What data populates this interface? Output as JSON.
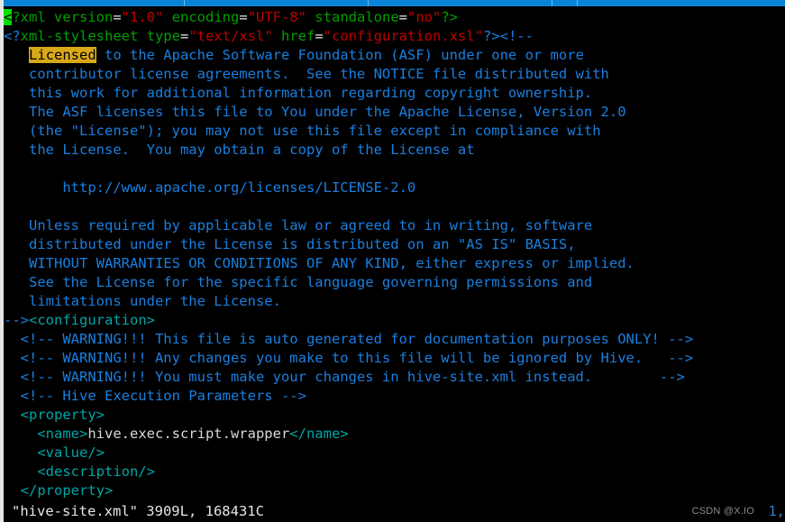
{
  "window": {
    "titlebar_color": "#0a84d8",
    "background_color": "#000000"
  },
  "editor": {
    "name": "vim",
    "filename": "hive-site.xml",
    "search_term": "Licensed",
    "cursor_char": "<",
    "lines": [
      {
        "id": "line-1",
        "segments": [
          {
            "text": "<",
            "style": "cursor"
          },
          {
            "text": "?xml version",
            "style": "green"
          },
          {
            "text": "=",
            "style": "white"
          },
          {
            "text": "\"1.0\"",
            "style": "red"
          },
          {
            "text": " encoding",
            "style": "green"
          },
          {
            "text": "=",
            "style": "white"
          },
          {
            "text": "\"UTF-8\"",
            "style": "red"
          },
          {
            "text": " standalone",
            "style": "green"
          },
          {
            "text": "=",
            "style": "white"
          },
          {
            "text": "\"no\"",
            "style": "red"
          },
          {
            "text": "?>",
            "style": "green"
          }
        ]
      },
      {
        "id": "line-2",
        "segments": [
          {
            "text": "<?",
            "style": "blue"
          },
          {
            "text": "xml-stylesheet type",
            "style": "green"
          },
          {
            "text": "=",
            "style": "white"
          },
          {
            "text": "\"text/xsl\"",
            "style": "red"
          },
          {
            "text": " href",
            "style": "green"
          },
          {
            "text": "=",
            "style": "white"
          },
          {
            "text": "\"configuration.xsl\"",
            "style": "red"
          },
          {
            "text": "?>",
            "style": "blue"
          },
          {
            "text": "<!--",
            "style": "blue"
          }
        ]
      },
      {
        "id": "line-3",
        "segments": [
          {
            "text": "   ",
            "style": "blue"
          },
          {
            "text": "Licensed",
            "style": "search-hit"
          },
          {
            "text": " to the Apache Software Foundation (ASF) under one or more",
            "style": "blue"
          }
        ]
      },
      {
        "id": "line-4",
        "segments": [
          {
            "text": "   contributor license agreements.  See the NOTICE file distributed with",
            "style": "blue"
          }
        ]
      },
      {
        "id": "line-5",
        "segments": [
          {
            "text": "   this work for additional information regarding copyright ownership.",
            "style": "blue"
          }
        ]
      },
      {
        "id": "line-6",
        "segments": [
          {
            "text": "   The ASF licenses this file to You under the Apache License, Version 2.0",
            "style": "blue"
          }
        ]
      },
      {
        "id": "line-7",
        "segments": [
          {
            "text": "   (the \"License\"); you may not use this file except in compliance with",
            "style": "blue"
          }
        ]
      },
      {
        "id": "line-8",
        "segments": [
          {
            "text": "   the License.  You may obtain a copy of the License at",
            "style": "blue"
          }
        ]
      },
      {
        "id": "line-9",
        "segments": [
          {
            "text": "",
            "style": "blue"
          }
        ]
      },
      {
        "id": "line-10",
        "segments": [
          {
            "text": "       http://www.apache.org/licenses/LICENSE-2.0",
            "style": "blue"
          }
        ]
      },
      {
        "id": "line-11",
        "segments": [
          {
            "text": "",
            "style": "blue"
          }
        ]
      },
      {
        "id": "line-12",
        "segments": [
          {
            "text": "   Unless required by applicable law or agreed to in writing, software",
            "style": "blue"
          }
        ]
      },
      {
        "id": "line-13",
        "segments": [
          {
            "text": "   distributed under the License is distributed on an \"AS IS\" BASIS,",
            "style": "blue"
          }
        ]
      },
      {
        "id": "line-14",
        "segments": [
          {
            "text": "   WITHOUT WARRANTIES OR CONDITIONS OF ANY KIND, either express or implied.",
            "style": "blue"
          }
        ]
      },
      {
        "id": "line-15",
        "segments": [
          {
            "text": "   See the License for the specific language governing permissions and",
            "style": "blue"
          }
        ]
      },
      {
        "id": "line-16",
        "segments": [
          {
            "text": "   limitations under the License.",
            "style": "blue"
          }
        ]
      },
      {
        "id": "line-17",
        "segments": [
          {
            "text": "-->",
            "style": "blue"
          },
          {
            "text": "<configuration>",
            "style": "teal"
          }
        ]
      },
      {
        "id": "line-18",
        "segments": [
          {
            "text": "  <!-- WARNING!!! This file is auto generated for documentation purposes ONLY! -->",
            "style": "blue"
          }
        ]
      },
      {
        "id": "line-19",
        "segments": [
          {
            "text": "  <!-- WARNING!!! Any changes you make to this file will be ignored by Hive.   -->",
            "style": "blue"
          }
        ]
      },
      {
        "id": "line-20",
        "segments": [
          {
            "text": "  <!-- WARNING!!! You must make your changes in hive-site.xml instead.        -->",
            "style": "blue"
          }
        ]
      },
      {
        "id": "line-21",
        "segments": [
          {
            "text": "  <!-- Hive Execution Parameters -->",
            "style": "blue"
          }
        ]
      },
      {
        "id": "line-22",
        "segments": [
          {
            "text": "  <property>",
            "style": "teal"
          }
        ]
      },
      {
        "id": "line-23",
        "segments": [
          {
            "text": "    <name>",
            "style": "teal"
          },
          {
            "text": "hive.exec.script.wrapper",
            "style": "plain"
          },
          {
            "text": "</name>",
            "style": "teal"
          }
        ]
      },
      {
        "id": "line-24",
        "segments": [
          {
            "text": "    <value/>",
            "style": "teal"
          }
        ]
      },
      {
        "id": "line-25",
        "segments": [
          {
            "text": "    <description/>",
            "style": "teal"
          }
        ]
      },
      {
        "id": "line-26",
        "segments": [
          {
            "text": "  </property>",
            "style": "teal"
          }
        ]
      }
    ]
  },
  "status": {
    "text": "\"hive-site.xml\" 3909L, 168431C",
    "ruler": "1,"
  },
  "watermark": {
    "text": "CSDN @X.IO"
  }
}
